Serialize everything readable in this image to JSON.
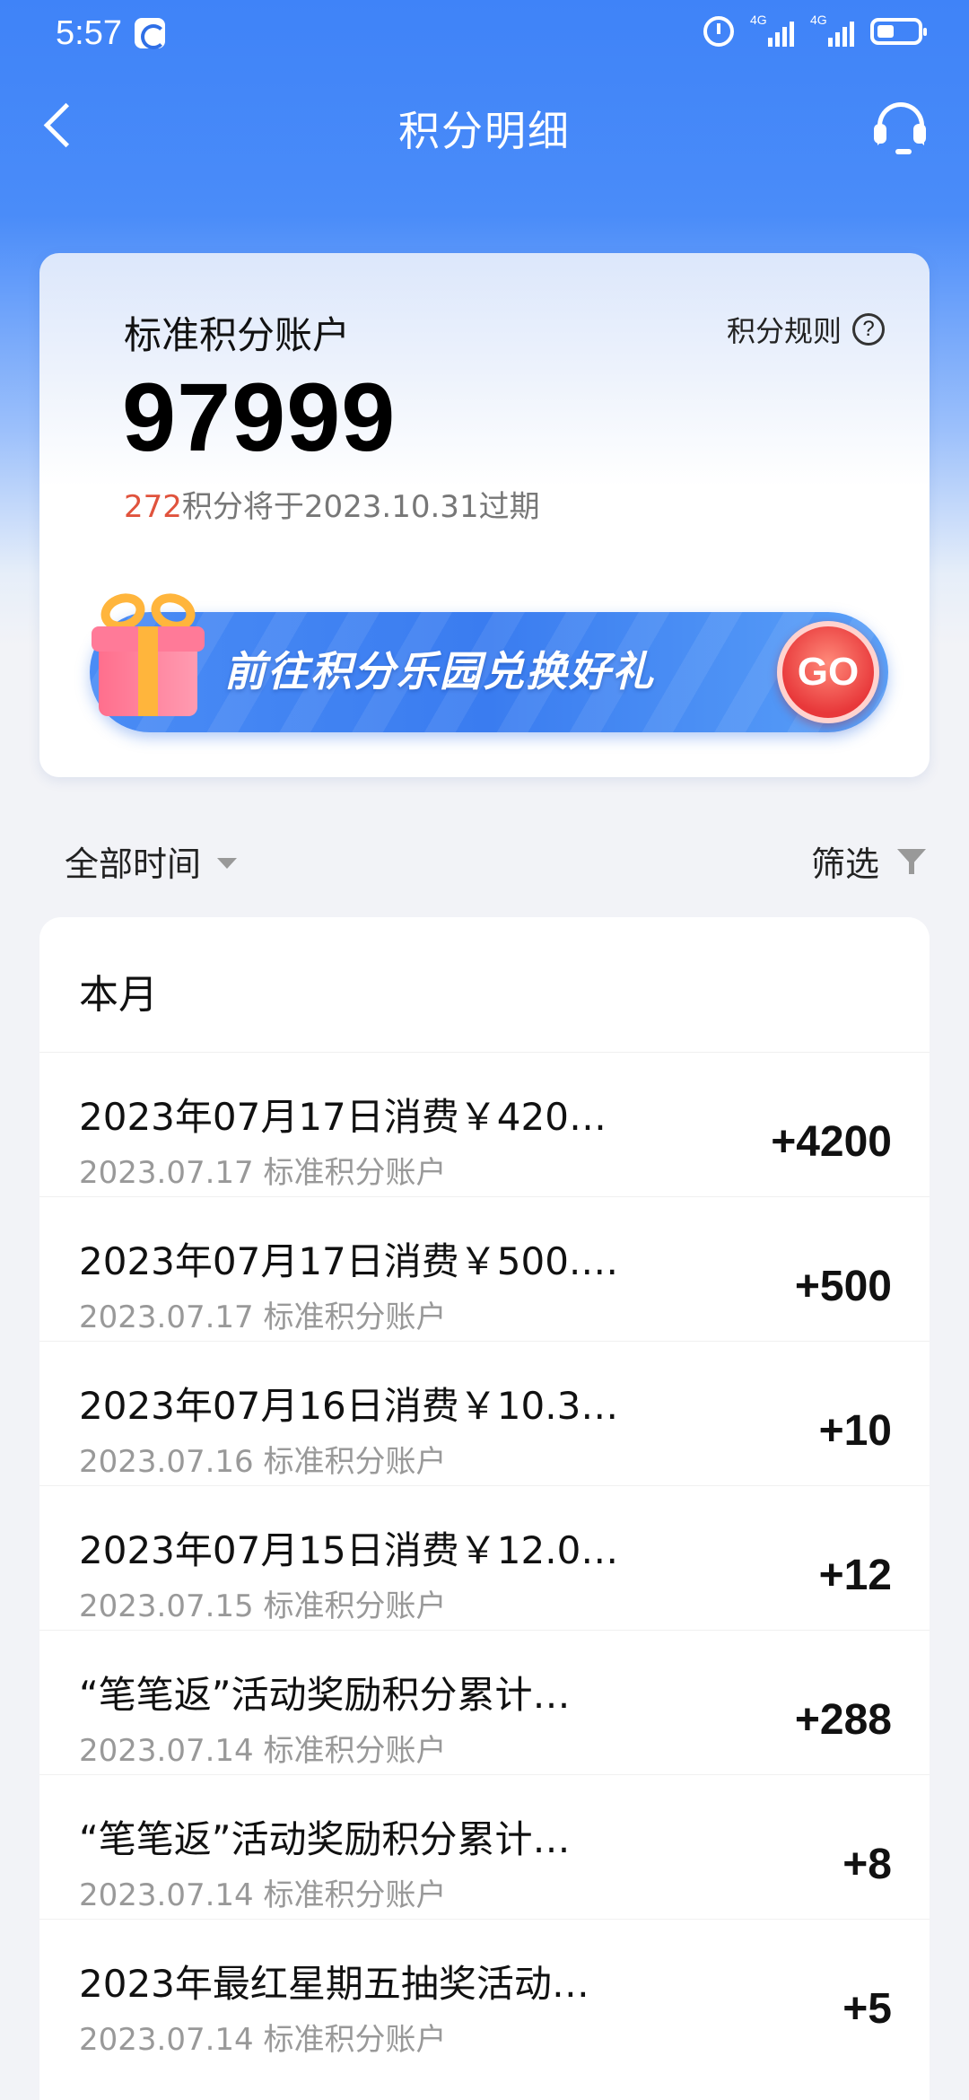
{
  "status_bar": {
    "time": "5:57",
    "network_1": "4G",
    "network_2": "4G",
    "icons": [
      "app-notification-icon",
      "alarm-icon",
      "signal-icon",
      "signal-icon",
      "battery-icon"
    ]
  },
  "nav": {
    "title": "积分明细",
    "back_icon": "back-arrow-icon",
    "service_icon": "customer-service-headset-icon"
  },
  "account": {
    "title": "标准积分账户",
    "rules_label": "积分规则",
    "rules_icon": "question-circle-icon",
    "total_points": "97999",
    "expiring_amount": "272",
    "expiring_text": "积分将于2023.10.31过期"
  },
  "promo": {
    "text": "前往积分乐园兑换好礼",
    "go_label": "GO",
    "icon": "gift-box-icon"
  },
  "filters": {
    "time_label": "全部时间",
    "filter_label": "筛选",
    "filter_icon": "funnel-icon"
  },
  "list": {
    "section_title": "本月",
    "items": [
      {
        "title": "2023年07月17日消费￥420…",
        "sub": "2023.07.17 标准积分账户",
        "amount": "+4200"
      },
      {
        "title": "2023年07月17日消费￥500.…",
        "sub": "2023.07.17 标准积分账户",
        "amount": "+500"
      },
      {
        "title": "2023年07月16日消费￥10.3…",
        "sub": "2023.07.16 标准积分账户",
        "amount": "+10"
      },
      {
        "title": "2023年07月15日消费￥12.0…",
        "sub": "2023.07.15 标准积分账户",
        "amount": "+12"
      },
      {
        "title": "“笔笔返”活动奖励积分累计…",
        "sub": "2023.07.14 标准积分账户",
        "amount": "+288"
      },
      {
        "title": "“笔笔返”活动奖励积分累计…",
        "sub": "2023.07.14 标准积分账户",
        "amount": "+8"
      },
      {
        "title": "2023年最红星期五抽奖活动…",
        "sub": "2023.07.14 标准积分账户",
        "amount": "+5"
      }
    ]
  },
  "colors": {
    "brand_blue": "#3f83f8",
    "expire_red": "#e0533d",
    "go_red": "#e8383a",
    "gift_ribbon": "#ffb53c"
  }
}
